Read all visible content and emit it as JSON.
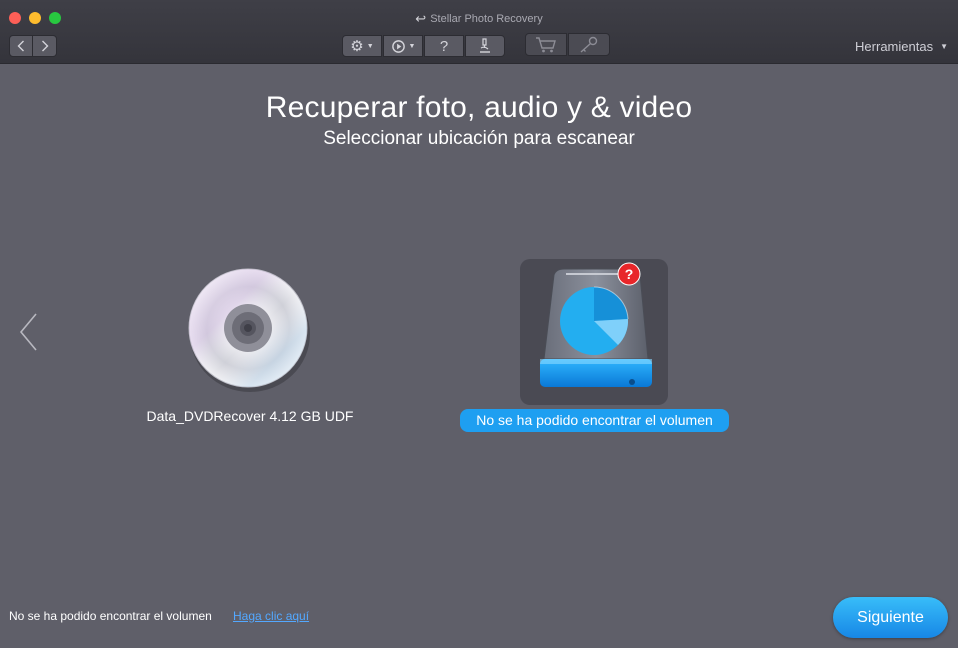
{
  "window": {
    "title": "Stellar Photo Recovery"
  },
  "toolbar": {
    "back_icon": "chevron-left-icon",
    "forward_icon": "chevron-right-icon",
    "help_label": "?",
    "tools_menu_label": "Herramientas"
  },
  "main": {
    "title": "Recuperar foto, audio y & video",
    "subtitle": "Seleccionar ubicación para escanear",
    "items": [
      {
        "label": "Data_DVDRecover 4.12 GB UDF",
        "icon": "dvd-icon",
        "selected": false
      },
      {
        "label": "No se ha podido encontrar el volumen",
        "icon": "unknown-drive-icon",
        "badge": "?",
        "selected": true
      }
    ]
  },
  "footer": {
    "status_text": "No se ha podido encontrar el volumen",
    "help_link": "Haga clic aquí",
    "next_button": "Siguiente"
  },
  "colors": {
    "background": "#5f5f69",
    "accent": "#1e9ff1",
    "badge": "#e8262a"
  }
}
